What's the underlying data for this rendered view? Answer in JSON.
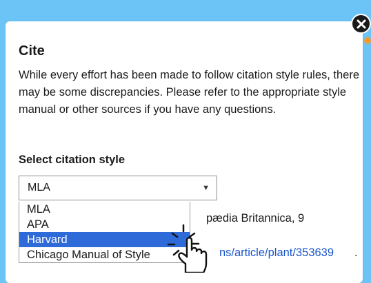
{
  "dialog": {
    "title": "Cite",
    "description": "While every effort has been made to follow citation style rules, there may be some discrepancies. Please refer to the appropriate style manual or other sources if you have any questions.",
    "select_label": "Select citation style",
    "selected_value": "MLA",
    "options": [
      "MLA",
      "APA",
      "Harvard",
      "Chicago Manual of Style"
    ],
    "highlighted_option": "Harvard",
    "citation_fragment": "pædia Britannica, 9",
    "citation_link_fragment": "ns/article/plant/353639",
    "citation_link_end": "."
  },
  "icons": {
    "close": "close-icon",
    "dropdown_arrow": "dropdown-arrow-icon",
    "cursor": "hand-pointer-icon"
  },
  "colors": {
    "background": "#6cc4f6",
    "highlight": "#2f6bd8",
    "link": "#1a56c9",
    "accent_dot": "#f39a32"
  }
}
